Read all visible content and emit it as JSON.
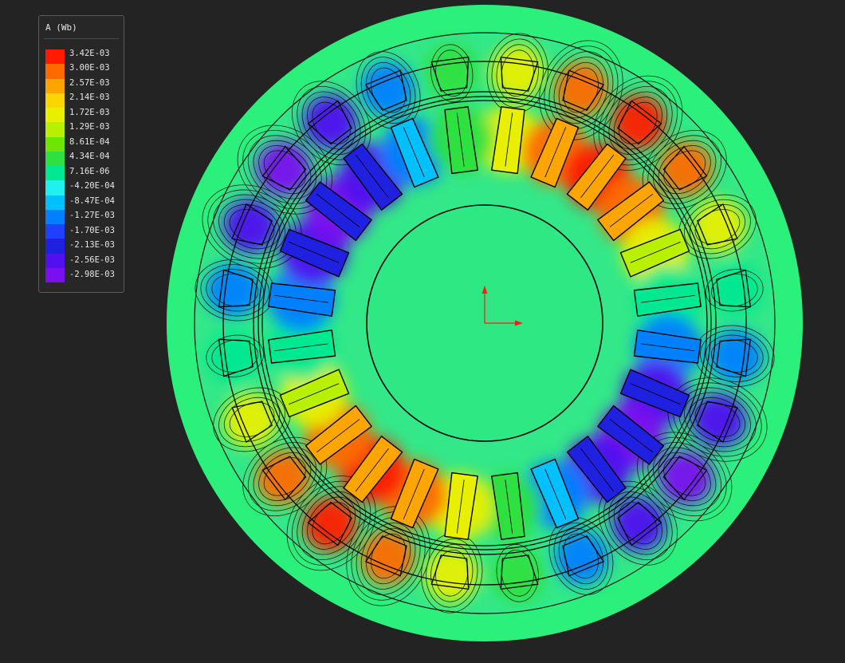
{
  "legend": {
    "title": "A (Wb)",
    "values": [
      "3.42E-03",
      "3.00E-03",
      "2.57E-03",
      "2.14E-03",
      "1.72E-03",
      "1.29E-03",
      "8.61E-04",
      "4.34E-04",
      "7.16E-06",
      "-4.20E-04",
      "-8.47E-04",
      "-1.27E-03",
      "-1.70E-03",
      "-2.13E-03",
      "-2.56E-03",
      "-2.98E-03"
    ],
    "colors": [
      "#ff1a00",
      "#ff6a00",
      "#ffa500",
      "#ffd500",
      "#e8f000",
      "#b8f000",
      "#6ee600",
      "#2ee040",
      "#00e890",
      "#20f0f0",
      "#00c0ff",
      "#0080ff",
      "#2040ff",
      "#2020e0",
      "#5010f0",
      "#7a10f0"
    ]
  },
  "colors": {
    "background": "#232323",
    "outer_ring": "#2bf07c",
    "rotor_core": "#2ee884"
  }
}
